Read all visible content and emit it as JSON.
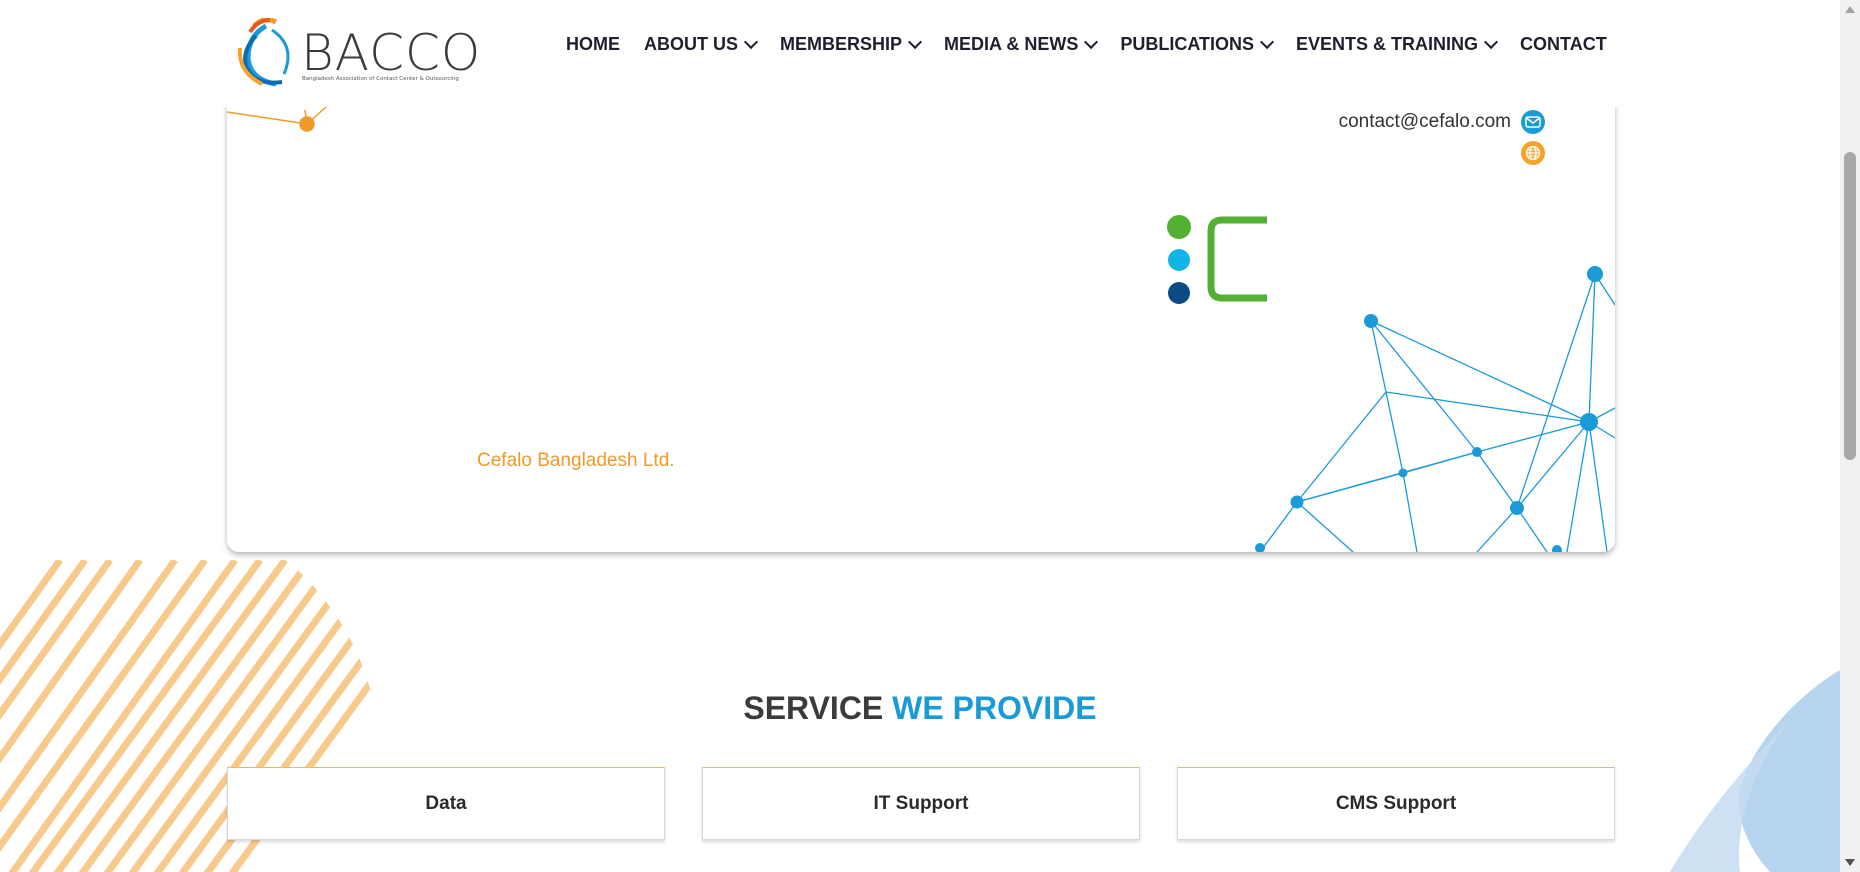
{
  "header": {
    "logo_text": "BACCO",
    "logo_subtitle": "Bangladesh Association of Contact Center & Outsourcing",
    "nav": [
      {
        "label": "HOME",
        "has_dropdown": false
      },
      {
        "label": "ABOUT US",
        "has_dropdown": true
      },
      {
        "label": "MEMBERSHIP",
        "has_dropdown": true
      },
      {
        "label": "MEDIA & NEWS",
        "has_dropdown": true
      },
      {
        "label": "PUBLICATIONS",
        "has_dropdown": true
      },
      {
        "label": "EVENTS & TRAINING",
        "has_dropdown": true
      },
      {
        "label": "CONTACT",
        "has_dropdown": false
      }
    ]
  },
  "company": {
    "email": "contact@cefalo.com",
    "name": "Cefalo Bangladesh Ltd.",
    "icons": [
      "mail-icon",
      "globe-icon"
    ]
  },
  "services": {
    "title_dark": "SERVICE",
    "title_blue": "WE PROVIDE",
    "items": [
      "Data",
      "IT Support",
      "CMS Support"
    ]
  },
  "colors": {
    "accent_blue": "#1a9bd7",
    "accent_orange": "#f19a2a",
    "logo_green": "#52b033",
    "logo_cyan": "#12b3e6",
    "logo_navy": "#0c4a84"
  }
}
